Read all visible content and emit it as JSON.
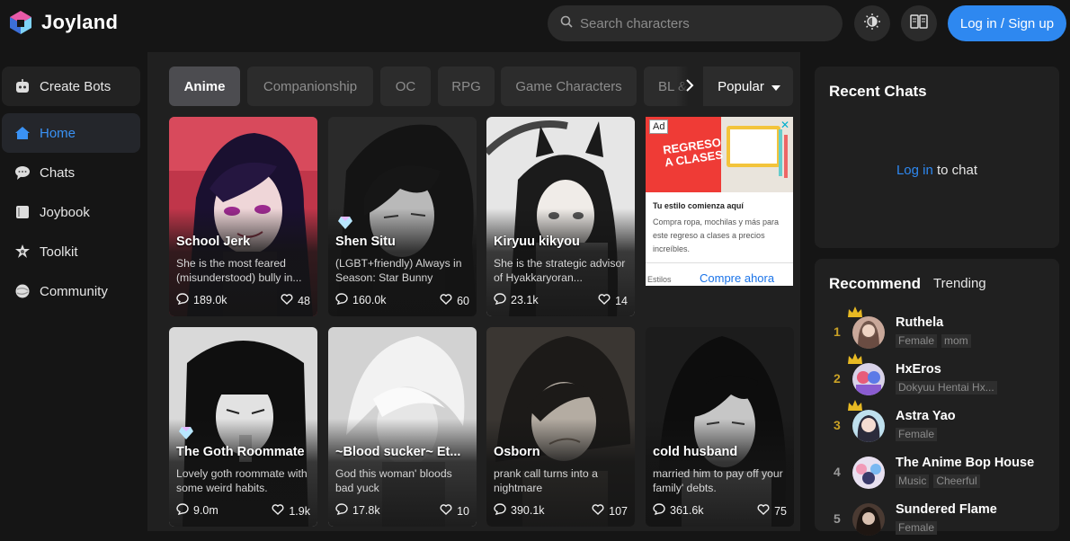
{
  "app": {
    "name": "Joyland"
  },
  "search": {
    "placeholder": "Search characters"
  },
  "header": {
    "login_label": "Log in / Sign up",
    "theme_icon": "brightness-icon",
    "book_icon": "book-icon"
  },
  "sidebar": {
    "items": [
      {
        "label": "Create Bots",
        "icon": "bot-icon"
      },
      {
        "label": "Home",
        "icon": "home-icon",
        "active": true
      },
      {
        "label": "Chats",
        "icon": "chat-bubble-icon"
      },
      {
        "label": "Joybook",
        "icon": "book-icon"
      },
      {
        "label": "Toolkit",
        "icon": "gear-icon"
      },
      {
        "label": "Community",
        "icon": "planet-icon"
      }
    ]
  },
  "tabs": [
    {
      "label": "Anime",
      "active": true
    },
    {
      "label": "Companionship"
    },
    {
      "label": "OC"
    },
    {
      "label": "RPG"
    },
    {
      "label": "Game Characters"
    },
    {
      "label": "BL & ..."
    }
  ],
  "sort": {
    "label": "Popular"
  },
  "cards": [
    {
      "name": "School Jerk",
      "desc": "She is the most feared (misunderstood) bully in...",
      "chats": "189.0k",
      "likes": "48"
    },
    {
      "name": "Shen Situ",
      "desc": "(LGBT+friendly) Always in Season: Star Bunny",
      "chats": "160.0k",
      "likes": "60"
    },
    {
      "name": "Kiryuu kikyou",
      "desc": "She is the strategic advisor of Hyakkaryoran...",
      "chats": "23.1k",
      "likes": "14"
    },
    {
      "name": "The Goth Roommate",
      "desc": "Lovely goth roommate with some weird habits.",
      "chats": "9.0m",
      "likes": "1.9k"
    },
    {
      "name": "~Blood sucker~ Et...",
      "desc": "God this woman' bloods bad yuck",
      "chats": "17.8k",
      "likes": "10"
    },
    {
      "name": "Osborn",
      "desc": "prank call turns into a nightmare",
      "chats": "390.1k",
      "likes": "107"
    },
    {
      "name": "cold husband",
      "desc": "married him to pay off your family' debts.",
      "chats": "361.6k",
      "likes": "75"
    }
  ],
  "ad": {
    "label": "Ad",
    "close": "✕",
    "banner_line1": "REGRESO",
    "banner_line2": "A CLASES",
    "headline": "Tu estilo comienza aquí",
    "body": "Compra ropa, mochilas y más para este regreso a clases a precios increíbles.",
    "brand": "Estilos",
    "cta": "Compre ahora"
  },
  "recent_chats": {
    "title": "Recent Chats",
    "login_link": "Log in",
    "login_suffix": " to chat"
  },
  "recommend": {
    "title": "Recommend",
    "trending": "Trending",
    "items": [
      {
        "rank": "1",
        "name": "Ruthela",
        "tags": [
          "Female",
          "mom"
        ]
      },
      {
        "rank": "2",
        "name": "HxEros",
        "tags": [
          "Dokyuu Hentai Hx..."
        ]
      },
      {
        "rank": "3",
        "name": "Astra Yao",
        "tags": [
          "Female"
        ]
      },
      {
        "rank": "4",
        "name": "The Anime Bop House",
        "tags": [
          "Music",
          "Cheerful"
        ]
      },
      {
        "rank": "5",
        "name": "Sundered Flame",
        "tags": [
          "Female"
        ]
      }
    ]
  },
  "colors": {
    "accent": "#2e88f0",
    "gold": "#c9a126",
    "background": "#151515",
    "panel": "#202020"
  }
}
